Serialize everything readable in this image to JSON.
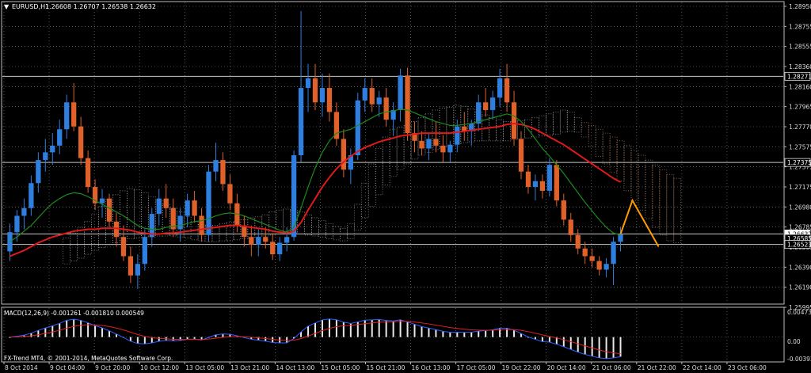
{
  "header": {
    "symbol": "EURUSD,H1",
    "ohlc": "1.26608 1.26707 1.26538 1.26632"
  },
  "price_axis": {
    "labels": [
      "1.28950",
      "1.28755",
      "1.28555",
      "1.28360",
      "1.28160",
      "1.27965",
      "1.27770",
      "1.27575",
      "1.27375",
      "1.27175",
      "1.26980",
      "1.26785",
      "1.26585",
      "1.26390",
      "1.26190",
      "1.25995"
    ]
  },
  "price_tags": [
    {
      "name": "level-1-28271",
      "text": "1.28271",
      "price": 1.28271,
      "style": "outline"
    },
    {
      "name": "level-1-27375",
      "text": "1.27375",
      "price": 1.27375,
      "style": "outline"
    },
    {
      "name": "current-price",
      "text": "1.26632",
      "price": 1.26632,
      "style": "current"
    },
    {
      "name": "level-1-26585",
      "text": "1.26585",
      "price": 1.26585,
      "style": "outline"
    },
    {
      "name": "level-1-26523",
      "text": "1.26523",
      "price": 1.26523,
      "style": "outline"
    }
  ],
  "horizontal_lines": [
    1.28271,
    1.27375,
    1.26632,
    1.26523
  ],
  "time_axis": {
    "labels": [
      "8 Oct 2014",
      "9 Oct 04:00",
      "9 Oct 20:00",
      "10 Oct 12:00",
      "13 Oct 05:00",
      "13 Oct 21:00",
      "14 Oct 13:00",
      "15 Oct 05:00",
      "15 Oct 21:00",
      "16 Oct 13:00",
      "17 Oct 05:00",
      "19 Oct 22:00",
      "20 Oct 14:00",
      "21 Oct 06:00",
      "21 Oct 22:00",
      "22 Oct 14:00",
      "23 Oct 06:00"
    ]
  },
  "macd": {
    "label": "MACD(12,26,9) -0.001261 -0.001810 0.000549",
    "axis_labels": [
      "0.00473",
      "0.00",
      "-0.00392"
    ]
  },
  "footer": {
    "line1": "FX-Trend MT4, © 2001-2014, MetaQuotes Software Corp."
  },
  "colors": {
    "bull": "#2f7fe0",
    "bear": "#e0622a",
    "ma_slow": "#e01a1a",
    "ma_fast": "#1c8a1c",
    "cloud_a": "#d9a27a",
    "cloud_b": "#bbbbbb",
    "forecast": "#ff9a00",
    "grid": "#8a8a8a",
    "macd_main": "#3060ff",
    "macd_signal": "#e02020"
  },
  "chart_data": {
    "type": "candlestick",
    "symbol": "EURUSD",
    "timeframe": "H1",
    "ylim": [
      1.2591,
      1.2904
    ],
    "points": [
      [
        1.2645,
        1.2674,
        1.2635,
        1.2665
      ],
      [
        1.2665,
        1.2688,
        1.2655,
        1.2682
      ],
      [
        1.2682,
        1.27,
        1.2668,
        1.269
      ],
      [
        1.269,
        1.2724,
        1.2682,
        1.2716
      ],
      [
        1.2716,
        1.2748,
        1.2706,
        1.274
      ],
      [
        1.274,
        1.2762,
        1.2728,
        1.2748
      ],
      [
        1.2748,
        1.2768,
        1.2735,
        1.2755
      ],
      [
        1.2755,
        1.2782,
        1.2746,
        1.2772
      ],
      [
        1.2772,
        1.2808,
        1.2762,
        1.28
      ],
      [
        1.28,
        1.282,
        1.277,
        1.2775
      ],
      [
        1.2775,
        1.2785,
        1.2735,
        1.2742
      ],
      [
        1.2742,
        1.275,
        1.2706,
        1.2712
      ],
      [
        1.2712,
        1.272,
        1.2688,
        1.2695
      ],
      [
        1.2695,
        1.271,
        1.268,
        1.27
      ],
      [
        1.27,
        1.2705,
        1.267,
        1.2676
      ],
      [
        1.2676,
        1.2685,
        1.265,
        1.266
      ],
      [
        1.266,
        1.2672,
        1.2635,
        1.264
      ],
      [
        1.264,
        1.265,
        1.2612,
        1.262
      ],
      [
        1.262,
        1.2642,
        1.2606,
        1.2632
      ],
      [
        1.2632,
        1.2668,
        1.2625,
        1.266
      ],
      [
        1.266,
        1.269,
        1.265,
        1.2684
      ],
      [
        1.2684,
        1.271,
        1.2672,
        1.27
      ],
      [
        1.27,
        1.2715,
        1.268,
        1.269
      ],
      [
        1.269,
        1.27,
        1.266,
        1.2668
      ],
      [
        1.2668,
        1.269,
        1.2655,
        1.2682
      ],
      [
        1.2682,
        1.2705,
        1.267,
        1.2698
      ],
      [
        1.2698,
        1.2708,
        1.2675,
        1.2682
      ],
      [
        1.2682,
        1.269,
        1.2655,
        1.2662
      ],
      [
        1.2662,
        1.2735,
        1.2655,
        1.2728
      ],
      [
        1.2728,
        1.2758,
        1.2718,
        1.274
      ],
      [
        1.274,
        1.2748,
        1.2708,
        1.2715
      ],
      [
        1.2715,
        1.2725,
        1.2688,
        1.2695
      ],
      [
        1.2695,
        1.2705,
        1.2665,
        1.2672
      ],
      [
        1.2672,
        1.2682,
        1.265,
        1.266
      ],
      [
        1.266,
        1.2672,
        1.264,
        1.2652
      ],
      [
        1.2652,
        1.2668,
        1.264,
        1.266
      ],
      [
        1.266,
        1.267,
        1.2648,
        1.2655
      ],
      [
        1.2655,
        1.2664,
        1.2636,
        1.2642
      ],
      [
        1.2642,
        1.266,
        1.2635,
        1.2654
      ],
      [
        1.2654,
        1.267,
        1.2645,
        1.266
      ],
      [
        1.266,
        1.275,
        1.2656,
        1.2745
      ],
      [
        1.2745,
        1.2895,
        1.2738,
        1.2815
      ],
      [
        1.2815,
        1.284,
        1.279,
        1.2825
      ],
      [
        1.2825,
        1.284,
        1.2792,
        1.28
      ],
      [
        1.28,
        1.283,
        1.2785,
        1.2815
      ],
      [
        1.2815,
        1.283,
        1.278,
        1.279
      ],
      [
        1.279,
        1.28,
        1.2755,
        1.2762
      ],
      [
        1.2762,
        1.2772,
        1.2722,
        1.273
      ],
      [
        1.273,
        1.2752,
        1.2715,
        1.2745
      ],
      [
        1.2745,
        1.281,
        1.274,
        1.2802
      ],
      [
        1.2802,
        1.2825,
        1.279,
        1.2815
      ],
      [
        1.2815,
        1.2825,
        1.279,
        1.2798
      ],
      [
        1.2798,
        1.2812,
        1.2785,
        1.2805
      ],
      [
        1.2805,
        1.2815,
        1.2775,
        1.2782
      ],
      [
        1.2782,
        1.28,
        1.2765,
        1.2792
      ],
      [
        1.2792,
        1.2835,
        1.278,
        1.2828
      ],
      [
        1.2828,
        1.2836,
        1.276,
        1.2768
      ],
      [
        1.2768,
        1.278,
        1.2748,
        1.276
      ],
      [
        1.276,
        1.277,
        1.2745,
        1.2752
      ],
      [
        1.2752,
        1.2768,
        1.274,
        1.2762
      ],
      [
        1.2762,
        1.278,
        1.2748,
        1.2755
      ],
      [
        1.2755,
        1.2766,
        1.2738,
        1.2748
      ],
      [
        1.2748,
        1.276,
        1.2738,
        1.2756
      ],
      [
        1.2756,
        1.2782,
        1.2748,
        1.2775
      ],
      [
        1.2775,
        1.279,
        1.276,
        1.277
      ],
      [
        1.277,
        1.2782,
        1.2755,
        1.2778
      ],
      [
        1.2778,
        1.2808,
        1.277,
        1.28
      ],
      [
        1.28,
        1.2815,
        1.2785,
        1.2792
      ],
      [
        1.2792,
        1.2812,
        1.2782,
        1.2805
      ],
      [
        1.2805,
        1.2835,
        1.2795,
        1.2825
      ],
      [
        1.2825,
        1.284,
        1.279,
        1.28
      ],
      [
        1.28,
        1.2812,
        1.2755,
        1.2762
      ],
      [
        1.2762,
        1.277,
        1.272,
        1.2728
      ],
      [
        1.2728,
        1.2735,
        1.2705,
        1.2712
      ],
      [
        1.2712,
        1.2725,
        1.2698,
        1.2718
      ],
      [
        1.2718,
        1.2725,
        1.27,
        1.2708
      ],
      [
        1.2708,
        1.2742,
        1.2702,
        1.2735
      ],
      [
        1.2735,
        1.274,
        1.2692,
        1.2698
      ],
      [
        1.2698,
        1.2705,
        1.2672,
        1.2678
      ],
      [
        1.2678,
        1.2685,
        1.2655,
        1.2662
      ],
      [
        1.2662,
        1.2668,
        1.2642,
        1.2648
      ],
      [
        1.2648,
        1.2655,
        1.2632,
        1.264
      ],
      [
        1.264,
        1.2648,
        1.2628,
        1.2635
      ],
      [
        1.2635,
        1.264,
        1.262,
        1.2626
      ],
      [
        1.2626,
        1.2638,
        1.2618,
        1.2632
      ],
      [
        1.2632,
        1.266,
        1.261,
        1.2655
      ],
      [
        1.2655,
        1.267,
        1.2645,
        1.2663
      ]
    ],
    "ma_fast": [
      1.2655,
      1.266,
      1.2666,
      1.2672,
      1.268,
      1.2688,
      1.2695,
      1.27,
      1.2704,
      1.2706,
      1.2705,
      1.2702,
      1.2698,
      1.2694,
      1.269,
      1.2686,
      1.2682,
      1.2677,
      1.2672,
      1.2669,
      1.2668,
      1.2668,
      1.267,
      1.2671,
      1.2672,
      1.2674,
      1.2676,
      1.2677,
      1.2679,
      1.2682,
      1.2684,
      1.2685,
      1.2684,
      1.2682,
      1.2679,
      1.2676,
      1.2673,
      1.267,
      1.2667,
      1.2665,
      1.267,
      1.269,
      1.2712,
      1.2732,
      1.2748,
      1.276,
      1.2768,
      1.277,
      1.2772,
      1.2776,
      1.278,
      1.2784,
      1.2788,
      1.279,
      1.2791,
      1.2793,
      1.2792,
      1.2789,
      1.2786,
      1.2783,
      1.278,
      1.2778,
      1.2776,
      1.2776,
      1.2777,
      1.2778,
      1.278,
      1.2782,
      1.2784,
      1.2786,
      1.2788,
      1.2786,
      1.278,
      1.2772,
      1.2762,
      1.2752,
      1.2744,
      1.2735,
      1.2726,
      1.2716,
      1.2706,
      1.2696,
      1.2687,
      1.2678,
      1.267,
      1.2664,
      1.2662
    ],
    "ma_slow": [
      1.264,
      1.2643,
      1.2646,
      1.265,
      1.2654,
      1.2657,
      1.266,
      1.2662,
      1.2664,
      1.2666,
      1.2667,
      1.2668,
      1.2668,
      1.2669,
      1.2669,
      1.2669,
      1.2668,
      1.2667,
      1.2665,
      1.2664,
      1.2663,
      1.2663,
      1.2664,
      1.2664,
      1.2665,
      1.2666,
      1.2667,
      1.2668,
      1.2669,
      1.267,
      1.2671,
      1.2672,
      1.2672,
      1.2671,
      1.267,
      1.2669,
      1.2668,
      1.2666,
      1.2665,
      1.2664,
      1.2666,
      1.2675,
      1.2688,
      1.27,
      1.2712,
      1.2722,
      1.2731,
      1.2738,
      1.2744,
      1.2749,
      1.2753,
      1.2756,
      1.2759,
      1.2761,
      1.2763,
      1.2765,
      1.2766,
      1.2767,
      1.2768,
      1.2768,
      1.2768,
      1.2768,
      1.2768,
      1.2769,
      1.277,
      1.2771,
      1.2772,
      1.2773,
      1.2774,
      1.2775,
      1.2777,
      1.2778,
      1.2777,
      1.2775,
      1.2772,
      1.2768,
      1.2764,
      1.276,
      1.2756,
      1.2751,
      1.2746,
      1.2741,
      1.2736,
      1.2731,
      1.2726,
      1.2721,
      1.2717
    ],
    "forecast": [
      [
        1.2663,
        1.2698,
        1.265
      ]
    ]
  }
}
